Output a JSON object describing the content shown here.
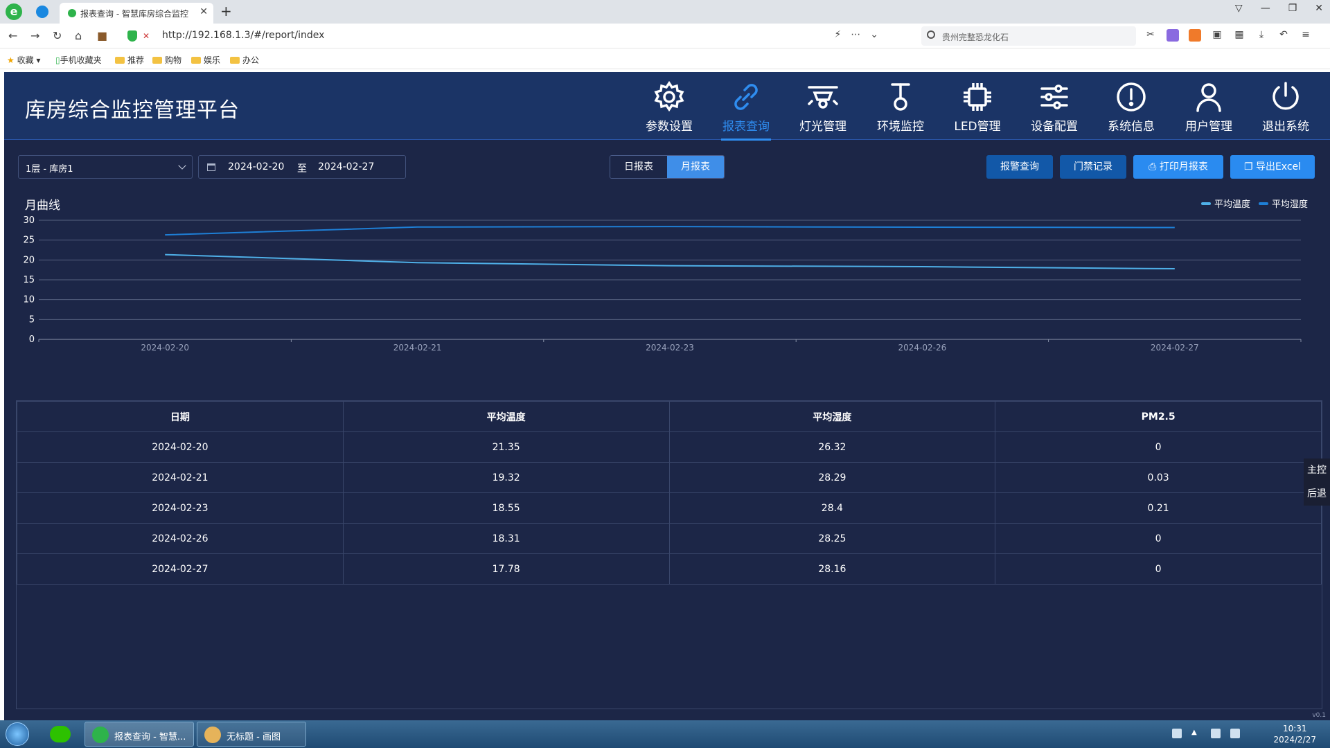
{
  "browser": {
    "tab_title": "报表查询 - 智慧库房综合监控",
    "url": "http://192.168.1.3/#/report/index",
    "search_text": "贵州完整恐龙化石",
    "bookmarks": [
      "收藏",
      "手机收藏夹",
      "推荐",
      "购物",
      "娱乐",
      "办公"
    ]
  },
  "app": {
    "title": "库房综合监控管理平台",
    "menu": [
      {
        "label": "参数设置",
        "icon": "gear-icon"
      },
      {
        "label": "报表查询",
        "icon": "link-icon",
        "active": true
      },
      {
        "label": "灯光管理",
        "icon": "lamp-icon"
      },
      {
        "label": "环境监控",
        "icon": "thermometer-icon"
      },
      {
        "label": "LED管理",
        "icon": "chip-icon"
      },
      {
        "label": "设备配置",
        "icon": "sliders-icon"
      },
      {
        "label": "系统信息",
        "icon": "alert-icon"
      },
      {
        "label": "用户管理",
        "icon": "user-icon"
      },
      {
        "label": "退出系统",
        "icon": "power-icon"
      }
    ]
  },
  "toolbar": {
    "room_select": "1层 - 库房1",
    "date_start": "2024-02-20",
    "date_sep": "至",
    "date_end": "2024-02-27",
    "daily_label": "日报表",
    "monthly_label": "月报表",
    "alarm_query_label": "报警查询",
    "access_record_label": "门禁记录",
    "print_label": "打印月报表",
    "export_label": "导出Excel"
  },
  "chart_data": {
    "type": "line",
    "title": "月曲线",
    "x": [
      "2024-02-20",
      "2024-02-21",
      "2024-02-23",
      "2024-02-26",
      "2024-02-27"
    ],
    "series": [
      {
        "name": "平均温度",
        "values": [
          21.35,
          19.32,
          18.55,
          18.31,
          17.78
        ],
        "color": "#4fb0e8"
      },
      {
        "name": "平均湿度",
        "values": [
          26.32,
          28.29,
          28.4,
          28.25,
          28.16
        ],
        "color": "#1e7fd6"
      }
    ],
    "ylim": [
      0,
      30
    ],
    "yticks": [
      "0",
      "5",
      "10",
      "15",
      "20",
      "25",
      "30"
    ],
    "grid": true,
    "legend": "top-right"
  },
  "table": {
    "headers": [
      "日期",
      "平均温度",
      "平均湿度",
      "PM2.5"
    ],
    "rows": [
      [
        "2024-02-20",
        "21.35",
        "26.32",
        "0"
      ],
      [
        "2024-02-21",
        "19.32",
        "28.29",
        "0.03"
      ],
      [
        "2024-02-23",
        "18.55",
        "28.4",
        "0.21"
      ],
      [
        "2024-02-26",
        "18.31",
        "28.25",
        "0"
      ],
      [
        "2024-02-27",
        "17.78",
        "28.16",
        "0"
      ]
    ]
  },
  "side_float": {
    "home": "主控",
    "back": "后退"
  },
  "version": "v0.1",
  "taskbar": {
    "task1": "报表查询 - 智慧...",
    "task2": "无标题 - 画图",
    "time": "10:31",
    "date": "2024/2/27"
  }
}
